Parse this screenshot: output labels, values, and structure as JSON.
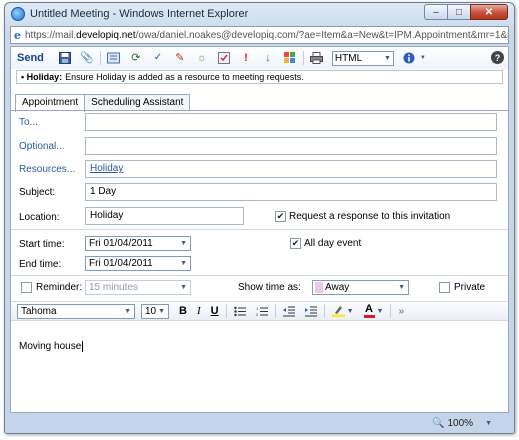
{
  "window": {
    "title": "Untitled Meeting - Windows Internet Explorer",
    "url_prefix": "https://mail.",
    "url_domain": "developiq.net",
    "url_rest": "/owa/daniel.noakes@developiq.com/?ae=Item&a=New&t=IPM.Appointment&mr=1&pspid=_13",
    "minimize": "–",
    "maximize": "□",
    "close": "✕"
  },
  "toolbar": {
    "send_label": "Send",
    "format_value": "HTML"
  },
  "infobar": {
    "bold_label": "• Holiday:",
    "message": "Ensure Holiday is added as a resource to meeting requests."
  },
  "tabs": [
    {
      "label": "Appointment",
      "active": true
    },
    {
      "label": "Scheduling Assistant",
      "active": false
    }
  ],
  "form": {
    "to_label": "To...",
    "to_value": "",
    "optional_label": "Optional...",
    "optional_value": "",
    "resources_label": "Resources...",
    "resources_value": "Holiday",
    "subject_label": "Subject:",
    "subject_value": "1 Day",
    "location_label": "Location:",
    "location_value": "Holiday",
    "request_response_label": "Request a response to this invitation",
    "request_response_checked": true,
    "start_label": "Start time:",
    "start_value": "Fri 01/04/2011",
    "end_label": "End time:",
    "end_value": "Fri 01/04/2011",
    "all_day_label": "All day event",
    "all_day_checked": true,
    "reminder_label": "Reminder:",
    "reminder_checked": false,
    "reminder_value": "15 minutes",
    "show_time_label": "Show time as:",
    "show_time_value": "Away",
    "show_time_color": "#e7c9f0",
    "private_label": "Private",
    "private_checked": false
  },
  "format_toolbar": {
    "font": "Tahoma",
    "size": "10",
    "bold": "B",
    "italic": "I",
    "underline": "U",
    "font_color_letter": "A"
  },
  "body": {
    "text": "Moving house"
  },
  "status": {
    "zoom": "100%"
  },
  "colors": {
    "link": "#2b5a9e",
    "send": "#15428b"
  }
}
